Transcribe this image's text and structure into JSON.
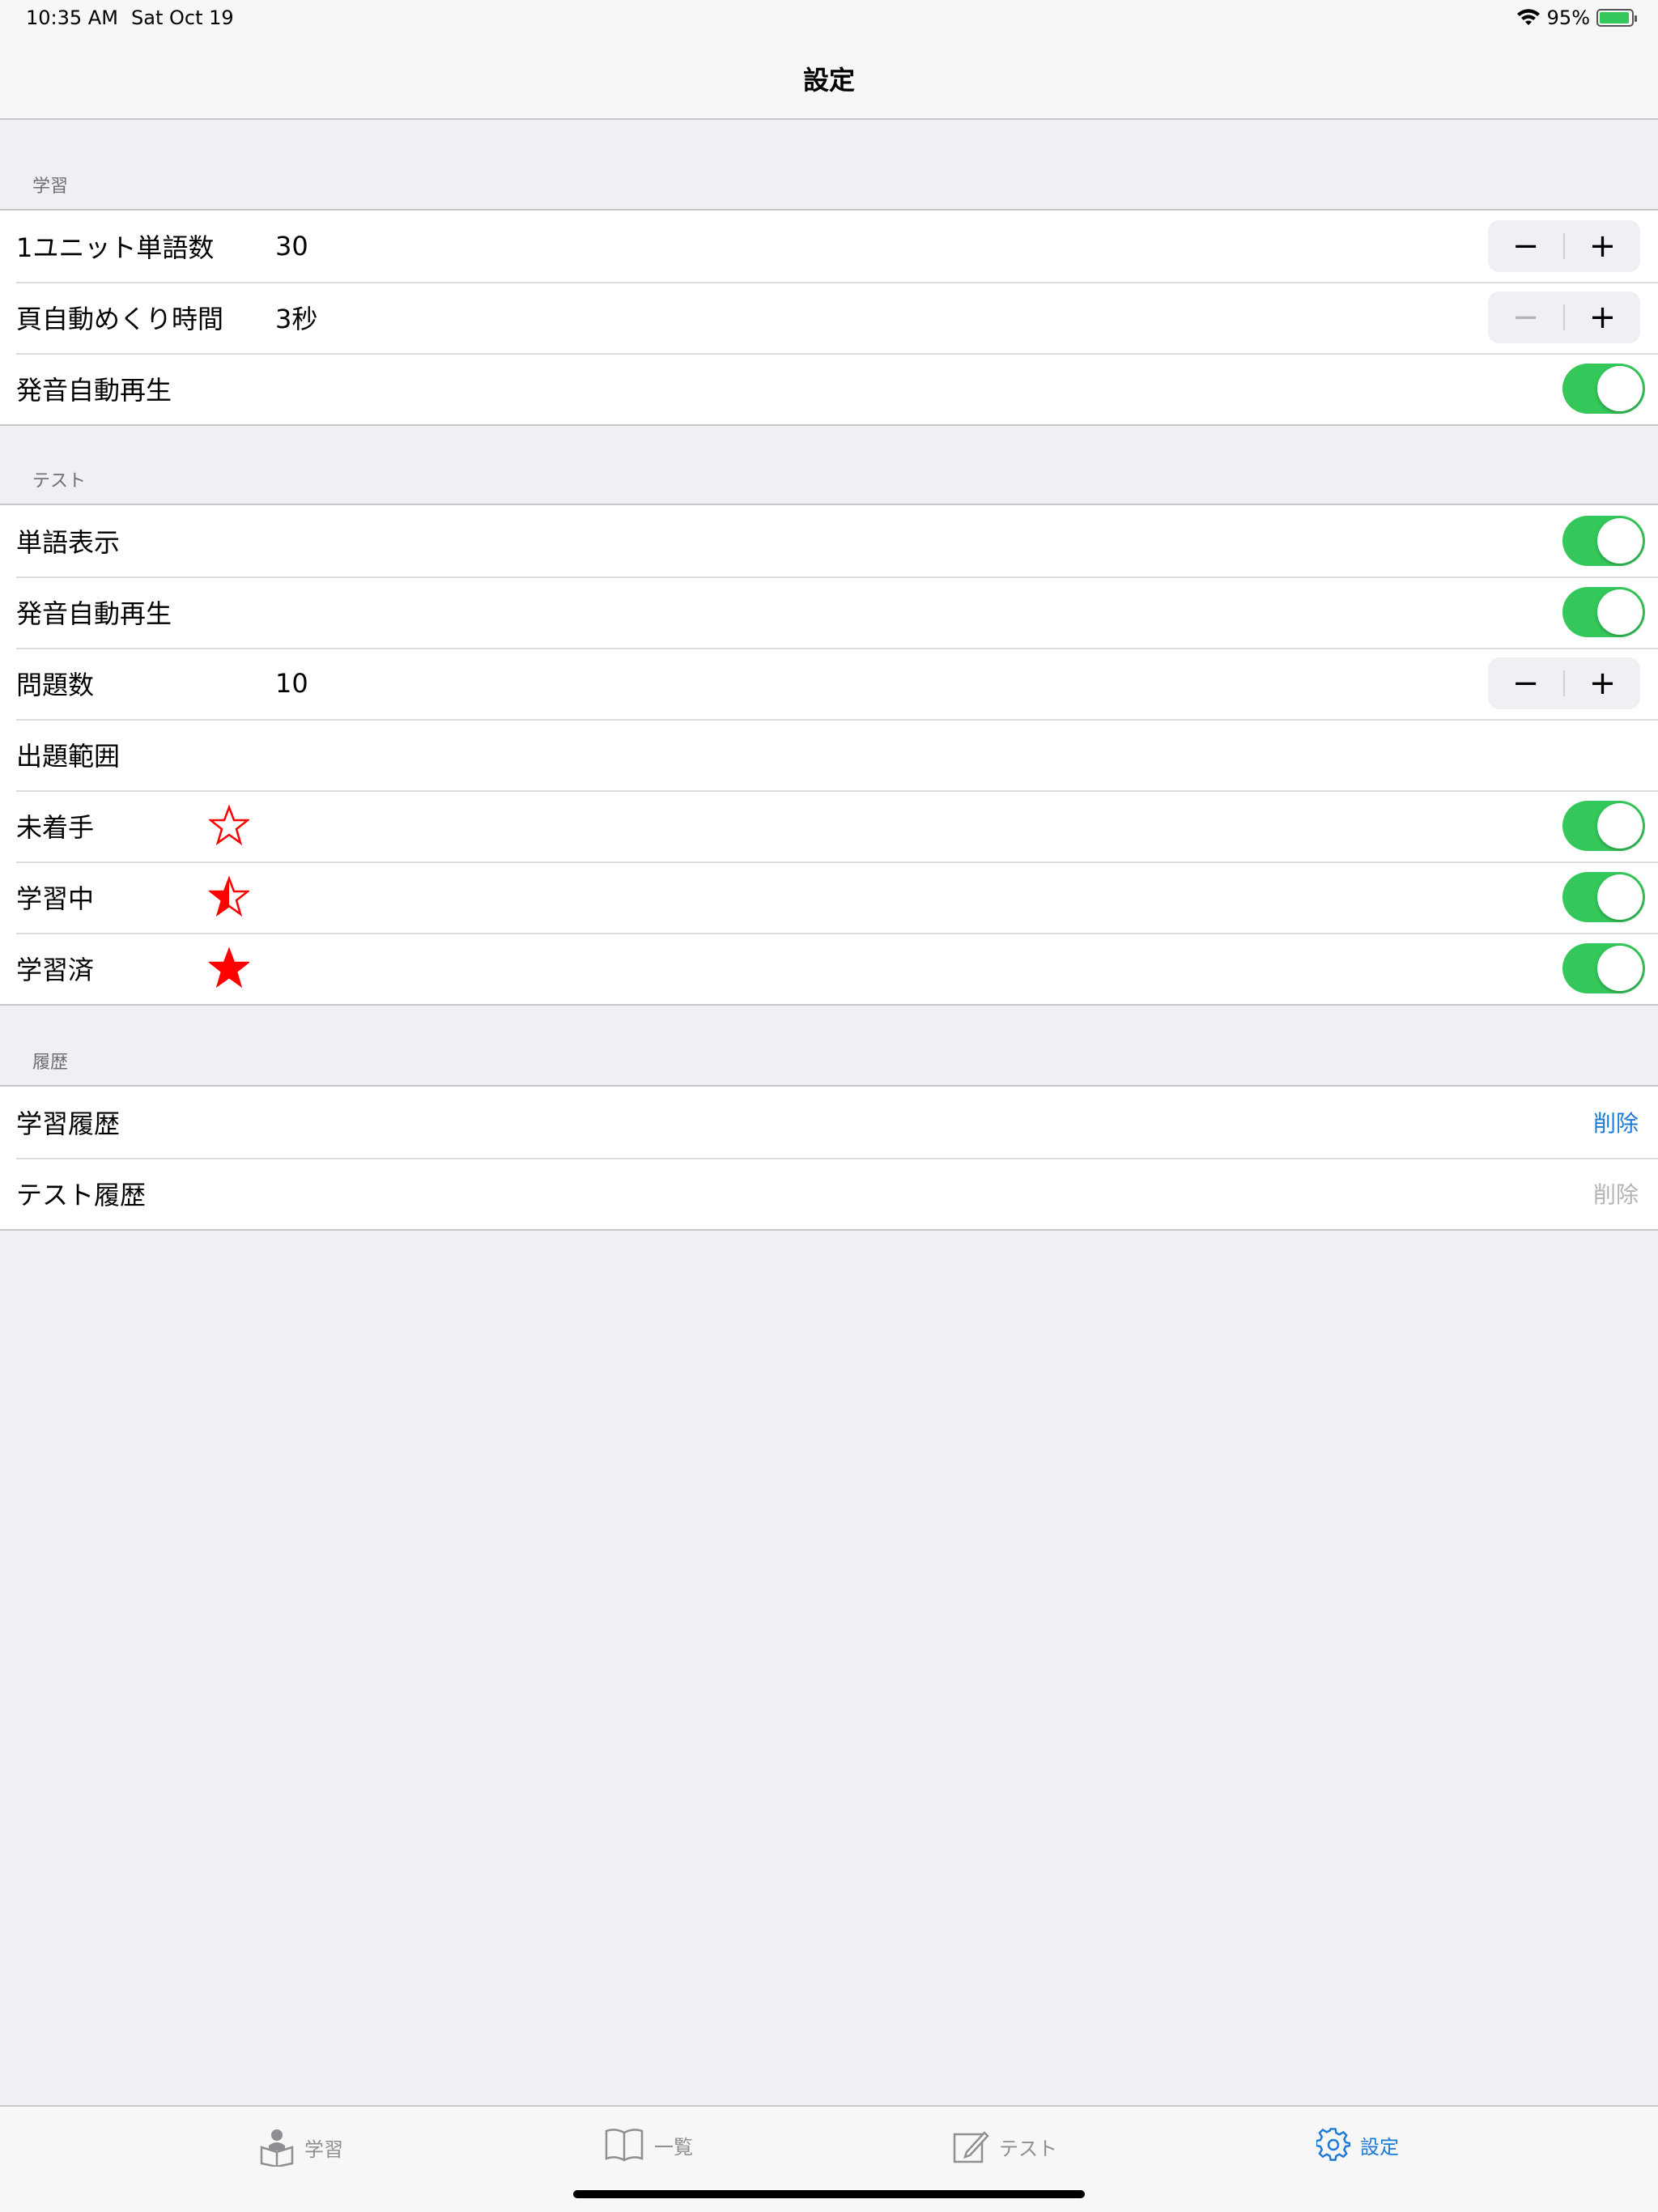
{
  "status_bar": {
    "time": "10:35 AM",
    "date": "Sat Oct 19",
    "battery_percent_label": "95%",
    "battery_level": 0.95
  },
  "nav": {
    "title": "設定"
  },
  "sections": {
    "study": {
      "header": "学習",
      "unit_words": {
        "label": "1ユニット単語数",
        "value": "30"
      },
      "auto_page": {
        "label": "頁自動めくり時間",
        "value": "3秒"
      },
      "auto_pron": {
        "label": "発音自動再生",
        "on": true
      }
    },
    "test": {
      "header": "テスト",
      "word_display": {
        "label": "単語表示",
        "on": true
      },
      "auto_pron": {
        "label": "発音自動再生",
        "on": true
      },
      "question_count": {
        "label": "問題数",
        "value": "10"
      },
      "range": {
        "label": "出題範囲"
      },
      "not_started": {
        "label": "未着手",
        "on": true
      },
      "in_progress": {
        "label": "学習中",
        "on": true
      },
      "completed": {
        "label": "学習済",
        "on": true
      }
    },
    "history": {
      "header": "履歴",
      "study_history": {
        "label": "学習履歴",
        "action": "削除"
      },
      "test_history": {
        "label": "テスト履歴",
        "action": "削除"
      }
    }
  },
  "stepper": {
    "minus": "−",
    "plus": "+"
  },
  "tabs": {
    "study": "学習",
    "list": "一覧",
    "test": "テスト",
    "settings": "設定"
  },
  "colors": {
    "accent": "#1a7ad9",
    "toggle_on": "#34c759",
    "star": "#ff0000"
  }
}
